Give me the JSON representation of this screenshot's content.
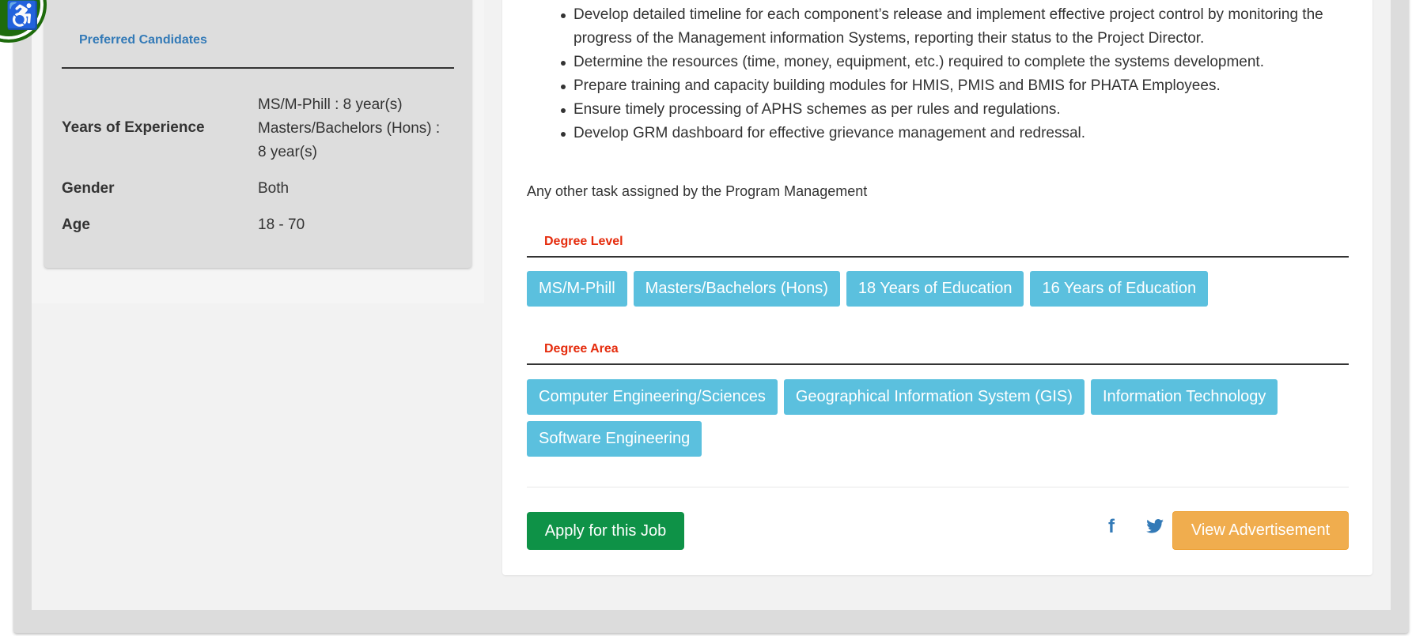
{
  "left": {
    "section_title": "Preferred Candidates",
    "rows": [
      {
        "label": "Years of Experience",
        "values": [
          "MS/M-Phill : 8 year(s)",
          "Masters/Bachelors (Hons) :",
          "8 year(s)"
        ]
      },
      {
        "label": "Gender",
        "values": [
          "Both"
        ]
      },
      {
        "label": "Age",
        "values": [
          "18 - 70"
        ]
      }
    ],
    "badge_icon": "wheelchair-accessibility-icon"
  },
  "main": {
    "responsibilities": [
      "Develop detailed timeline for each component’s release and implement effective project control by monitoring the progress of the Management information Systems, reporting their status to the Project Director.",
      "Determine the resources (time, money, equipment, etc.) required to complete the systems development.",
      "Prepare training and capacity building modules for HMIS, PMIS and BMIS for PHATA Employees.",
      "Ensure timely processing of APHS schemes as per rules and regulations.",
      "Develop GRM dashboard for effective grievance management and redressal."
    ],
    "other_task": "Any other task assigned by the Program Management",
    "degree_level": {
      "title": "Degree Level",
      "tags": [
        "MS/M-Phill",
        "Masters/Bachelors (Hons)",
        "18 Years of Education",
        "16 Years of Education"
      ]
    },
    "degree_area": {
      "title": "Degree Area",
      "tags": [
        "Computer Engineering/Sciences",
        "Geographical Information System (GIS)",
        "Information Technology",
        "Software Engineering"
      ]
    },
    "apply_label": "Apply for this Job",
    "view_ad_label": "View Advertisement",
    "facebook_glyph": "f"
  },
  "colors": {
    "tag": "#5bc0de",
    "apply": "#0e9247",
    "advertisement": "#f0ad4e",
    "section_heading": "#e52b0c",
    "link": "#337ab7"
  }
}
